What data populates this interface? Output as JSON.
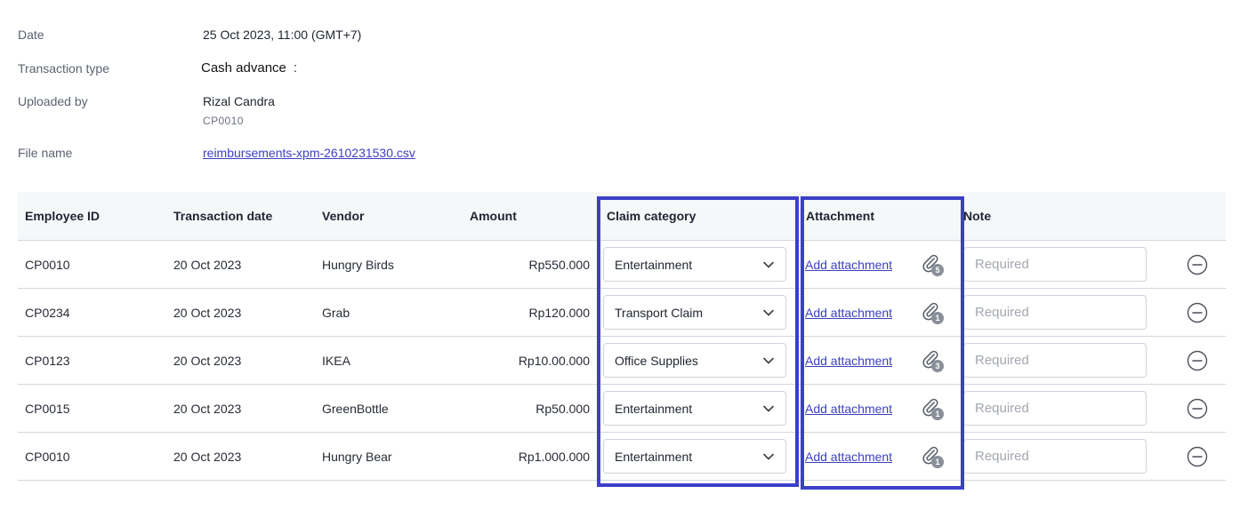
{
  "meta": {
    "date_label": "Date",
    "date_value": "25 Oct 2023, 11:00 (GMT+7)",
    "type_label": "Transaction type",
    "type_value": "Cash advance",
    "type_suffix": ":",
    "uploaded_label": "Uploaded by",
    "uploaded_name": "Rizal Candra",
    "uploaded_id": "CP0010",
    "file_label": "File name",
    "file_value": "reimbursements-xpm-2610231530.csv"
  },
  "table": {
    "headers": {
      "employee_id": "Employee ID",
      "transaction_date": "Transaction date",
      "vendor": "Vendor",
      "amount": "Amount",
      "claim_category": "Claim category",
      "attachment": "Attachment",
      "note": "Note"
    },
    "rows": [
      {
        "employee_id": "CP0010",
        "date": "20 Oct 2023",
        "vendor": "Hungry Birds",
        "amount": "Rp550.000",
        "category": "Entertainment",
        "attachment_link": "Add attachment",
        "attachment_count": "5",
        "note_placeholder": "Required"
      },
      {
        "employee_id": "CP0234",
        "date": "20 Oct 2023",
        "vendor": "Grab",
        "amount": "Rp120.000",
        "category": "Transport Claim",
        "attachment_link": "Add attachment",
        "attachment_count": "1",
        "note_placeholder": "Required"
      },
      {
        "employee_id": "CP0123",
        "date": "20 Oct 2023",
        "vendor": "IKEA",
        "amount": "Rp10.00.000",
        "category": "Office Supplies",
        "attachment_link": "Add attachment",
        "attachment_count": "3",
        "note_placeholder": "Required"
      },
      {
        "employee_id": "CP0015",
        "date": "20 Oct 2023",
        "vendor": "GreenBottle",
        "amount": "Rp50.000",
        "category": "Entertainment",
        "attachment_link": "Add attachment",
        "attachment_count": "1",
        "note_placeholder": "Required"
      },
      {
        "employee_id": "CP0010",
        "date": "20 Oct 2023",
        "vendor": "Hungry Bear",
        "amount": "Rp1.000.000",
        "category": "Entertainment",
        "attachment_link": "Add attachment",
        "attachment_count": "1",
        "note_placeholder": "Required"
      }
    ]
  },
  "icons": {
    "dropdown": "chevron-down-icon",
    "attachment": "paperclip-icon",
    "remove": "minus-circle-icon"
  },
  "colors": {
    "highlight": "#3c3fc8",
    "link": "#3d3fc2",
    "header_bg": "#f6f7f9",
    "badge": "#8a9099"
  }
}
